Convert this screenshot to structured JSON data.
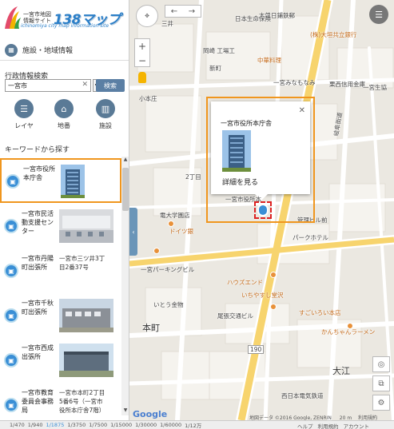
{
  "header": {
    "logo_small_line1": "一宮市地図",
    "logo_small_line2": "情報サイト",
    "logo_big": "138マップ",
    "logo_sub": "ichinomiya city map information site"
  },
  "sidebar": {
    "facility_section": "施設・地域情報",
    "admin_search_title": "行政情報検索",
    "search_value": "一宮市",
    "search_button": "検索",
    "tools": [
      {
        "label": "レイヤ",
        "icon": "layers-icon"
      },
      {
        "label": "地番",
        "icon": "house-icon"
      },
      {
        "label": "施設",
        "icon": "building-icon"
      }
    ],
    "keyword_title": "キーワードから探す",
    "results": [
      {
        "name": "一宮市役所本庁舎",
        "address": ""
      },
      {
        "name": "一宮市民活動支援センター",
        "address": ""
      },
      {
        "name": "一宮市丹陽町出張所",
        "address": "一宮市三ツ井3丁目2番37号"
      },
      {
        "name": "一宮市千秋町出張所",
        "address": ""
      },
      {
        "name": "一宮市西成出張所",
        "address": ""
      },
      {
        "name": "一宮市教育委員会事務局",
        "address": "一宮市本町2丁目5番6号（一宮市役所本庁舎7階）"
      }
    ]
  },
  "map": {
    "labels": {
      "top_bank": "木曽日鋪鉄郵",
      "bldg_right": "(株)大垣共立銀行",
      "hoken": "日本生命保険",
      "chuka": "中華料理",
      "oyoshi": "岡崎 工場工",
      "shinmachi": "新町",
      "shogaku": "小本庄",
      "ichinomiya_naganao": "一宮みなもなみ",
      "taiyoo": "栗西信用金庫",
      "ichidoseito": "一宮生協",
      "gifu_kaido": "岐阜街道",
      "dept": "2丁目",
      "keidai": "電大学園店",
      "doitsu_bank": "ドイツ銀",
      "park_hotel": "パークホテル",
      "ichinomiya_parking": "一宮パーキングビル",
      "honmachi": "本町",
      "haos_end": "ハウズエンド",
      "ichiyasu": "いちやすし堂沢",
      "itogo": "いとう金物",
      "owari_kyoto": "尾張交通ビル",
      "sugoiro": "すごいろい本店",
      "kanchan": "かんちゃんラーメン",
      "odori": "大江",
      "nishi_bank": "西日本電気鉄道",
      "route_190": "190",
      "route_190b": "190",
      "sanken": "三井",
      "kanrei": "管理ビル前"
    },
    "popup": {
      "title": "一宮市役所本庁舎",
      "more_link": "詳細を見る",
      "under_label": "一宮市役所本"
    },
    "attribution": "地図データ ©2016 Google, ZENRIN",
    "scale": "20 m",
    "terms": "利用規約",
    "google": "Google"
  },
  "bottom_bar": {
    "scales": [
      "1/470",
      "1/940",
      "1/1875",
      "1/3750",
      "1/7500",
      "1/15000",
      "1/30000",
      "1/60000",
      "1/12万"
    ],
    "current_scale_index": 2,
    "links": [
      "ヘルプ",
      "利用規約",
      "アカウント"
    ]
  },
  "colors": {
    "accent_blue": "#3a8fd6",
    "highlight_orange": "#f0961e",
    "button_blue": "#5b7fa4"
  }
}
